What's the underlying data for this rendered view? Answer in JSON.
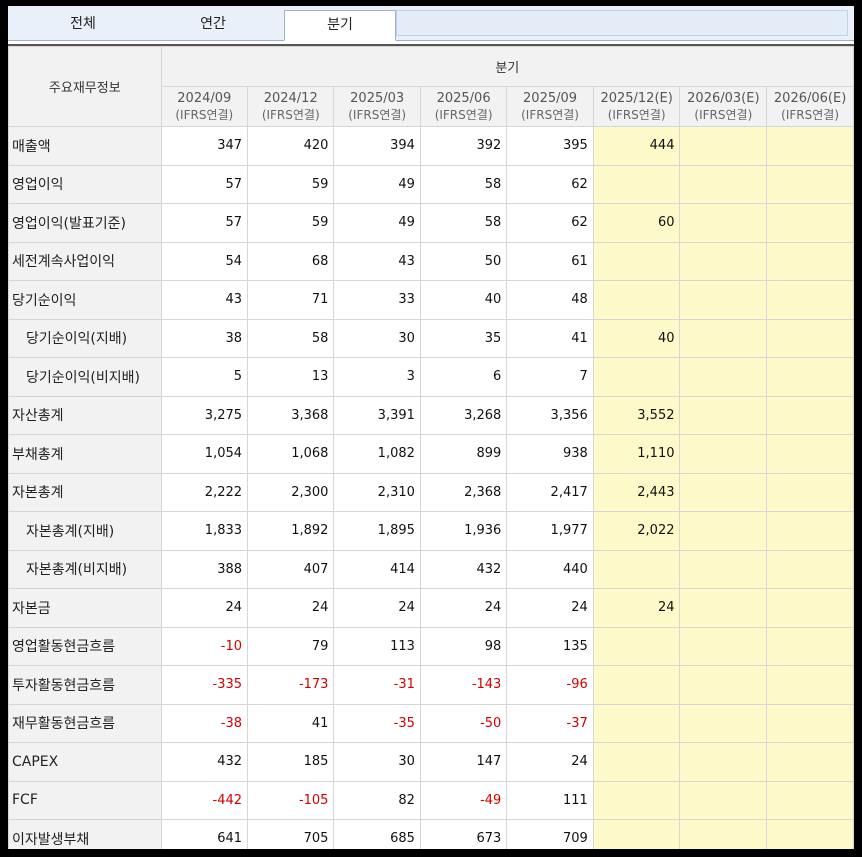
{
  "tabs": [
    "전체",
    "연간",
    "분기"
  ],
  "table": {
    "header_label": "주요재무정보",
    "group_label": "분기",
    "columns": [
      {
        "period": "2024/09",
        "basis": "(IFRS연결)"
      },
      {
        "period": "2024/12",
        "basis": "(IFRS연결)"
      },
      {
        "period": "2025/03",
        "basis": "(IFRS연결)"
      },
      {
        "period": "2025/06",
        "basis": "(IFRS연결)"
      },
      {
        "period": "2025/09",
        "basis": "(IFRS연결)"
      },
      {
        "period": "2025/12(E)",
        "basis": "(IFRS연결)"
      },
      {
        "period": "2026/03(E)",
        "basis": "(IFRS연결)"
      },
      {
        "period": "2026/06(E)",
        "basis": "(IFRS연결)"
      }
    ],
    "rows": [
      {
        "label": "매출액",
        "indent": false,
        "values": [
          "347",
          "420",
          "394",
          "392",
          "395",
          "444",
          "",
          ""
        ]
      },
      {
        "label": "영업이익",
        "indent": false,
        "values": [
          "57",
          "59",
          "49",
          "58",
          "62",
          "",
          "",
          ""
        ]
      },
      {
        "label": "영업이익(발표기준)",
        "indent": false,
        "values": [
          "57",
          "59",
          "49",
          "58",
          "62",
          "60",
          "",
          ""
        ]
      },
      {
        "label": "세전계속사업이익",
        "indent": false,
        "values": [
          "54",
          "68",
          "43",
          "50",
          "61",
          "",
          "",
          ""
        ]
      },
      {
        "label": "당기순이익",
        "indent": false,
        "values": [
          "43",
          "71",
          "33",
          "40",
          "48",
          "",
          "",
          ""
        ]
      },
      {
        "label": "당기순이익(지배)",
        "indent": true,
        "values": [
          "38",
          "58",
          "30",
          "35",
          "41",
          "40",
          "",
          ""
        ]
      },
      {
        "label": "당기순이익(비지배)",
        "indent": true,
        "values": [
          "5",
          "13",
          "3",
          "6",
          "7",
          "",
          "",
          ""
        ]
      },
      {
        "label": "자산총계",
        "indent": false,
        "values": [
          "3,275",
          "3,368",
          "3,391",
          "3,268",
          "3,356",
          "3,552",
          "",
          ""
        ]
      },
      {
        "label": "부채총계",
        "indent": false,
        "values": [
          "1,054",
          "1,068",
          "1,082",
          "899",
          "938",
          "1,110",
          "",
          ""
        ]
      },
      {
        "label": "자본총계",
        "indent": false,
        "values": [
          "2,222",
          "2,300",
          "2,310",
          "2,368",
          "2,417",
          "2,443",
          "",
          ""
        ]
      },
      {
        "label": "자본총계(지배)",
        "indent": true,
        "values": [
          "1,833",
          "1,892",
          "1,895",
          "1,936",
          "1,977",
          "2,022",
          "",
          ""
        ]
      },
      {
        "label": "자본총계(비지배)",
        "indent": true,
        "values": [
          "388",
          "407",
          "414",
          "432",
          "440",
          "",
          "",
          ""
        ]
      },
      {
        "label": "자본금",
        "indent": false,
        "values": [
          "24",
          "24",
          "24",
          "24",
          "24",
          "24",
          "",
          ""
        ]
      },
      {
        "label": "영업활동현금흐름",
        "indent": false,
        "values": [
          "-10",
          "79",
          "113",
          "98",
          "135",
          "",
          "",
          ""
        ]
      },
      {
        "label": "투자활동현금흐름",
        "indent": false,
        "values": [
          "-335",
          "-173",
          "-31",
          "-143",
          "-96",
          "",
          "",
          ""
        ]
      },
      {
        "label": "재무활동현금흐름",
        "indent": false,
        "values": [
          "-38",
          "41",
          "-35",
          "-50",
          "-37",
          "",
          "",
          ""
        ]
      },
      {
        "label": "CAPEX",
        "indent": false,
        "values": [
          "432",
          "185",
          "30",
          "147",
          "24",
          "",
          "",
          ""
        ]
      },
      {
        "label": "FCF",
        "indent": false,
        "values": [
          "-442",
          "-105",
          "82",
          "-49",
          "111",
          "",
          "",
          ""
        ]
      },
      {
        "label": "이자발생부채",
        "indent": false,
        "values": [
          "641",
          "705",
          "685",
          "673",
          "709",
          "",
          "",
          ""
        ]
      }
    ]
  },
  "colors": {
    "negative": "#d40000",
    "estimate_bg": "#fdf9c9",
    "header_bg": "#f2f2f2"
  }
}
